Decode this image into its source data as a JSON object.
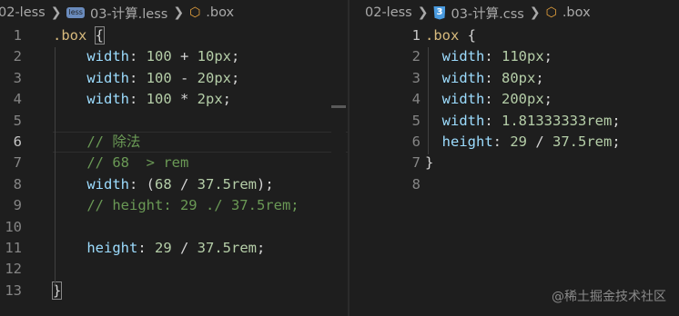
{
  "left": {
    "breadcrumb": {
      "folder": "02-less",
      "file_icon": "less-file-icon",
      "file": "03-计算.less",
      "symbol": ".box"
    },
    "lines": [
      {
        "n": "1",
        "tokens": [
          {
            "t": ".box",
            "c": "sel"
          },
          {
            "t": " ",
            "c": "pun"
          },
          {
            "t": "{",
            "c": "pun box"
          }
        ]
      },
      {
        "n": "2",
        "tokens": [
          {
            "t": "    width",
            "c": "prop"
          },
          {
            "t": ": ",
            "c": "pun"
          },
          {
            "t": "100",
            "c": "num"
          },
          {
            "t": " + ",
            "c": "pun"
          },
          {
            "t": "10px",
            "c": "num"
          },
          {
            "t": ";",
            "c": "pun"
          }
        ]
      },
      {
        "n": "3",
        "tokens": [
          {
            "t": "    width",
            "c": "prop"
          },
          {
            "t": ": ",
            "c": "pun"
          },
          {
            "t": "100",
            "c": "num"
          },
          {
            "t": " - ",
            "c": "pun"
          },
          {
            "t": "20px",
            "c": "num"
          },
          {
            "t": ";",
            "c": "pun"
          }
        ]
      },
      {
        "n": "4",
        "tokens": [
          {
            "t": "    width",
            "c": "prop"
          },
          {
            "t": ": ",
            "c": "pun"
          },
          {
            "t": "100",
            "c": "num"
          },
          {
            "t": " * ",
            "c": "pun"
          },
          {
            "t": "2px",
            "c": "num"
          },
          {
            "t": ";",
            "c": "pun"
          }
        ]
      },
      {
        "n": "5",
        "tokens": []
      },
      {
        "n": "6",
        "active": true,
        "tokens": [
          {
            "t": "    // 除法",
            "c": "com"
          }
        ]
      },
      {
        "n": "7",
        "tokens": [
          {
            "t": "    // 68  > rem",
            "c": "com"
          }
        ]
      },
      {
        "n": "8",
        "tokens": [
          {
            "t": "    width",
            "c": "prop"
          },
          {
            "t": ": (",
            "c": "pun"
          },
          {
            "t": "68",
            "c": "num"
          },
          {
            "t": " / ",
            "c": "pun"
          },
          {
            "t": "37.5rem",
            "c": "num"
          },
          {
            "t": ");",
            "c": "pun"
          }
        ]
      },
      {
        "n": "9",
        "tokens": [
          {
            "t": "    // height: 29 ./ 37.5rem;",
            "c": "com"
          }
        ]
      },
      {
        "n": "10",
        "tokens": []
      },
      {
        "n": "11",
        "tokens": [
          {
            "t": "    height",
            "c": "prop"
          },
          {
            "t": ": ",
            "c": "pun"
          },
          {
            "t": "29",
            "c": "num"
          },
          {
            "t": " / ",
            "c": "pun"
          },
          {
            "t": "37.5rem",
            "c": "num"
          },
          {
            "t": ";",
            "c": "pun"
          }
        ]
      },
      {
        "n": "12",
        "tokens": []
      },
      {
        "n": "13",
        "tokens": [
          {
            "t": "}",
            "c": "pun box"
          }
        ]
      }
    ]
  },
  "right": {
    "breadcrumb": {
      "folder": "02-less",
      "file_icon": "css-file-icon",
      "file": "03-计算.css",
      "symbol": ".box"
    },
    "lines": [
      {
        "n": "1",
        "active": true,
        "tokens": [
          {
            "t": ".box",
            "c": "sel"
          },
          {
            "t": " {",
            "c": "pun"
          }
        ]
      },
      {
        "n": "2",
        "tokens": [
          {
            "t": "  width",
            "c": "prop"
          },
          {
            "t": ": ",
            "c": "pun"
          },
          {
            "t": "110px",
            "c": "num"
          },
          {
            "t": ";",
            "c": "pun"
          }
        ]
      },
      {
        "n": "3",
        "tokens": [
          {
            "t": "  width",
            "c": "prop"
          },
          {
            "t": ": ",
            "c": "pun"
          },
          {
            "t": "80px",
            "c": "num"
          },
          {
            "t": ";",
            "c": "pun"
          }
        ]
      },
      {
        "n": "4",
        "tokens": [
          {
            "t": "  width",
            "c": "prop"
          },
          {
            "t": ": ",
            "c": "pun"
          },
          {
            "t": "200px",
            "c": "num"
          },
          {
            "t": ";",
            "c": "pun"
          }
        ]
      },
      {
        "n": "5",
        "tokens": [
          {
            "t": "  width",
            "c": "prop"
          },
          {
            "t": ": ",
            "c": "pun"
          },
          {
            "t": "1.81333333rem",
            "c": "num"
          },
          {
            "t": ";",
            "c": "pun"
          }
        ]
      },
      {
        "n": "6",
        "tokens": [
          {
            "t": "  height",
            "c": "prop"
          },
          {
            "t": ": ",
            "c": "pun"
          },
          {
            "t": "29",
            "c": "num"
          },
          {
            "t": " / ",
            "c": "pun"
          },
          {
            "t": "37.5rem",
            "c": "num"
          },
          {
            "t": ";",
            "c": "pun"
          }
        ]
      },
      {
        "n": "7",
        "tokens": [
          {
            "t": "}",
            "c": "pun"
          }
        ]
      },
      {
        "n": "8",
        "tokens": []
      }
    ]
  },
  "watermark": "@稀土掘金技术社区"
}
